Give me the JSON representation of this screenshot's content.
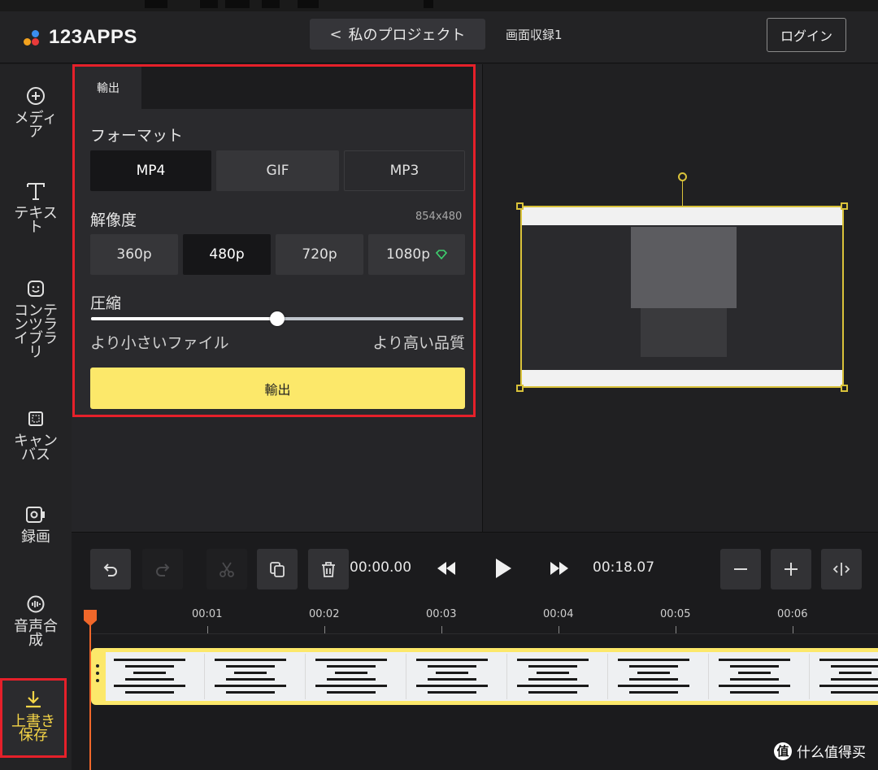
{
  "app": {
    "logo_text": "123APPS",
    "back_label": "私のプロジェクト",
    "project_name": "画面収録1",
    "login_label": "ログイン"
  },
  "colors": {
    "accent_yellow": "#fce86a",
    "highlight_red": "#e5202a",
    "playhead_orange": "#f0672a",
    "selection_gold": "#d9c23a",
    "premium_green": "#3ecf6e"
  },
  "sidebar": {
    "items": [
      {
        "label": "メディ\nア",
        "icon": "plus-circle-icon"
      },
      {
        "label": "テキス\nト",
        "icon": "text-t-icon"
      },
      {
        "label": "コンテ\nンツラ\nイブラ\nリ",
        "icon": "sticker-icon"
      },
      {
        "label": "キャン\nバス",
        "icon": "canvas-icon"
      },
      {
        "label": "録画",
        "icon": "record-icon"
      },
      {
        "label": "音声合\n成",
        "icon": "voice-icon"
      },
      {
        "label": "上書き\n保存",
        "icon": "download-icon"
      }
    ]
  },
  "export_panel": {
    "tab_label": "輸出",
    "format_label": "フォーマット",
    "formats": [
      "MP4",
      "GIF",
      "MP3"
    ],
    "selected_format": "MP4",
    "resolution_label": "解像度",
    "resolution_value": "854x480",
    "resolutions": [
      "360p",
      "480p",
      "720p",
      "1080p"
    ],
    "selected_resolution": "480p",
    "premium_icon": "gem-icon",
    "compression_label": "圧縮",
    "compression_level": 0.5,
    "smaller_file_label": "より小さいファイル",
    "higher_quality_label": "より高い品質",
    "export_button_label": "輸出"
  },
  "timeline": {
    "current_time": "00:00.00",
    "total_time": "00:18.07",
    "ruler_labels": [
      "00:01",
      "00:02",
      "00:03",
      "00:04",
      "00:05",
      "00:06"
    ]
  },
  "watermark": {
    "text": "什么值得买",
    "icon_glyph": "值"
  }
}
